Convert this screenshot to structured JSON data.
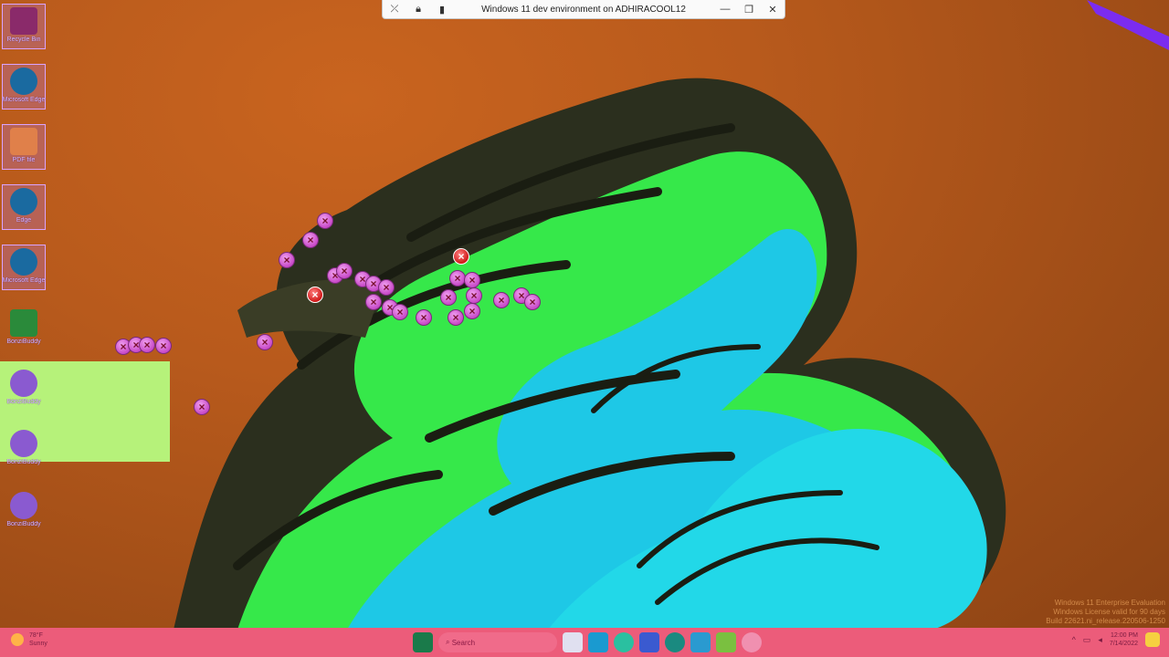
{
  "remote_bar": {
    "title": "Windows 11 dev environment on ADHIRACOOL12",
    "minimize": "—",
    "restore": "❐",
    "close": "✕"
  },
  "desktop_icons": [
    {
      "label": "Recycle Bin",
      "icon": "recycle-bin-icon",
      "color": "#8a2a6a"
    },
    {
      "label": "Microsoft Edge",
      "icon": "edge-icon",
      "color": "#1a6aa0"
    },
    {
      "label": "PDF file",
      "icon": "pdf-file-icon",
      "color": "#e0804a"
    },
    {
      "label": "Edge",
      "icon": "edge-icon",
      "color": "#1a6aa0"
    },
    {
      "label": "Microsoft Edge",
      "icon": "edge-icon",
      "color": "#1a6aa0"
    },
    {
      "label": "BonziBuddy",
      "icon": "folder-icon",
      "color": "#2a8a3a"
    },
    {
      "label": "BonziBuddy",
      "icon": "bonzi-icon",
      "color": "#8a5ad0"
    },
    {
      "label": "BonziBuddy",
      "icon": "bonzi-icon",
      "color": "#8a5ad0"
    },
    {
      "label": "BonziBuddy",
      "icon": "bonzi-icon",
      "color": "#8a5ad0"
    }
  ],
  "watermark": {
    "line1": "Windows 11 Enterprise Evaluation",
    "line2": "Windows License valid for 90 days",
    "line3": "Build 22621.ni_release.220506-1250"
  },
  "taskbar": {
    "weather_temp": "78°F",
    "weather_desc": "Sunny",
    "search_placeholder": "Search",
    "clock_time": "12:00 PM",
    "clock_date": "7/14/2022",
    "colors": {
      "bar": "#ec5c7a"
    }
  }
}
